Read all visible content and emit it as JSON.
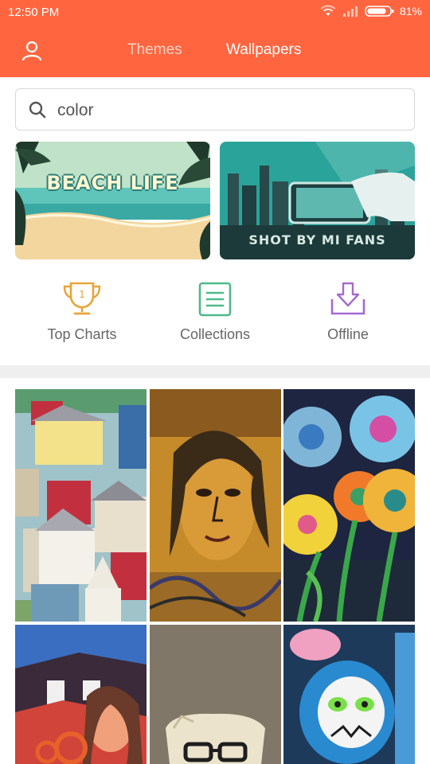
{
  "status_bar": {
    "time": "12:50 PM",
    "battery": "81%"
  },
  "tabs": {
    "themes": "Themes",
    "wallpapers": "Wallpapers",
    "active": "wallpapers"
  },
  "search": {
    "value": "color"
  },
  "banners": [
    {
      "title": "BEACH LIFE"
    },
    {
      "title": "SHOT BY MI FANS"
    }
  ],
  "categories": {
    "top_charts": "Top Charts",
    "collections": "Collections",
    "offline": "Offline"
  },
  "icons": {
    "profile": "person-outline-icon",
    "search": "search-icon",
    "top_charts": "trophy-icon",
    "collections": "list-icon",
    "offline": "download-tray-icon",
    "wifi": "wifi-icon",
    "signal": "signal-icon",
    "battery": "battery-icon"
  },
  "colors": {
    "header": "#ff6640",
    "trophy": "#e8a43a",
    "collections": "#4fb98a",
    "offline": "#a46ad0"
  },
  "wallpapers": [
    "colorful-houses-illustration",
    "graffiti-woman-portrait",
    "paper-flowers-art",
    "mural-woman-octopus",
    "sculpture-bust-with-glasses",
    "graffiti-monkey-skull"
  ]
}
